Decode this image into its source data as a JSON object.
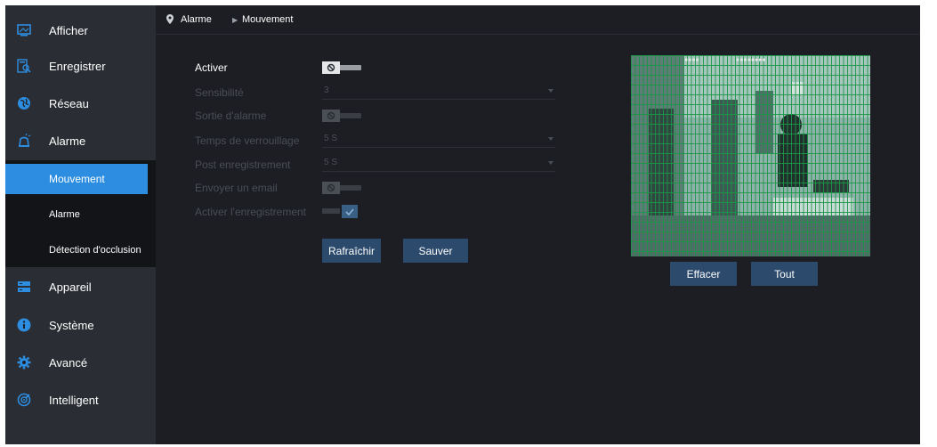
{
  "sidebar": {
    "items": [
      {
        "label": "Afficher",
        "icon": "monitor-icon"
      },
      {
        "label": "Enregistrer",
        "icon": "record-search-icon"
      },
      {
        "label": "Réseau",
        "icon": "globe-icon"
      },
      {
        "label": "Alarme",
        "icon": "alarm-bell-icon"
      },
      {
        "label": "Appareil",
        "icon": "device-drive-icon"
      },
      {
        "label": "Système",
        "icon": "info-icon"
      },
      {
        "label": "Avancé",
        "icon": "gear-icon"
      },
      {
        "label": "Intelligent",
        "icon": "smart-target-icon"
      }
    ],
    "submenu": [
      {
        "label": "Mouvement",
        "active": true
      },
      {
        "label": "Alarme",
        "active": false
      },
      {
        "label": "Détection d'occlusion",
        "active": false
      }
    ]
  },
  "breadcrumb": {
    "section": "Alarme",
    "page": "Mouvement"
  },
  "form": {
    "enable_label": "Activer",
    "sensitivity_label": "Sensibilité",
    "sensitivity_value": "3",
    "alarm_out_label": "Sortie d'alarme",
    "latch_time_label": "Temps de verrouillage",
    "latch_time_value": "5 S",
    "post_record_label": "Post enregistrement",
    "post_record_value": "5 S",
    "send_email_label": "Envoyer un email",
    "enable_record_label": "Activer l'enregistrement",
    "refresh_button": "Rafraîchir",
    "save_button": "Sauver"
  },
  "preview": {
    "clear_button": "Effacer",
    "all_button": "Tout"
  },
  "colors": {
    "accent": "#2d8de0",
    "button": "#2b4a6c",
    "grid": "#1a9646"
  }
}
